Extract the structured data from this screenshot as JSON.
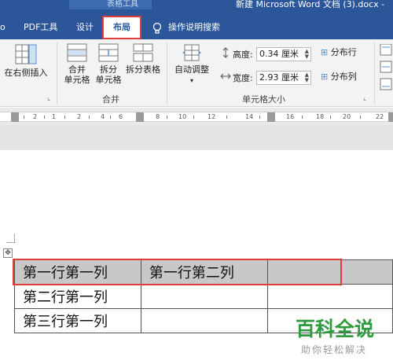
{
  "window": {
    "context_tab_group": "表格工具",
    "document_title": "新建 Microsoft Word 文档 (3).docx -"
  },
  "tabs": [
    {
      "label": "o"
    },
    {
      "label": "PDF工具"
    },
    {
      "label": "设计"
    },
    {
      "label": "布局",
      "active": true
    },
    {
      "label": "操作说明搜索"
    }
  ],
  "ribbon": {
    "insert_right": "在右侧插入",
    "merge_group": {
      "label": "合并",
      "merge_cells": {
        "line1": "合并",
        "line2": "单元格"
      },
      "split_cells": {
        "line1": "拆分",
        "line2": "单元格"
      },
      "split_table": "拆分表格"
    },
    "cell_size_group": {
      "label": "单元格大小",
      "autofit": "自动调整",
      "height_label": "高度:",
      "height_value": "0.34 厘米",
      "width_label": "宽度:",
      "width_value": "2.93 厘米",
      "distribute_rows": "分布行",
      "distribute_cols": "分布列"
    }
  },
  "ruler": {
    "numbers": [
      "2",
      "1",
      "2",
      "4",
      "6",
      "8",
      "10",
      "12",
      "14",
      "16",
      "18",
      "20",
      "22"
    ]
  },
  "table": {
    "rows": [
      [
        "第一行第一列",
        "第一行第二列",
        ""
      ],
      [
        "第二行第一列",
        "",
        ""
      ],
      [
        "第三行第一列",
        "",
        ""
      ]
    ],
    "selected_row": 0
  },
  "watermark": {
    "main": "百科全说",
    "sub": "助你轻松解决"
  },
  "colors": {
    "title_bar": "#2b579a",
    "highlight_border": "#e23b3b",
    "watermark_green": "#2e9b3e",
    "selected_fill": "#c8c8c8"
  }
}
